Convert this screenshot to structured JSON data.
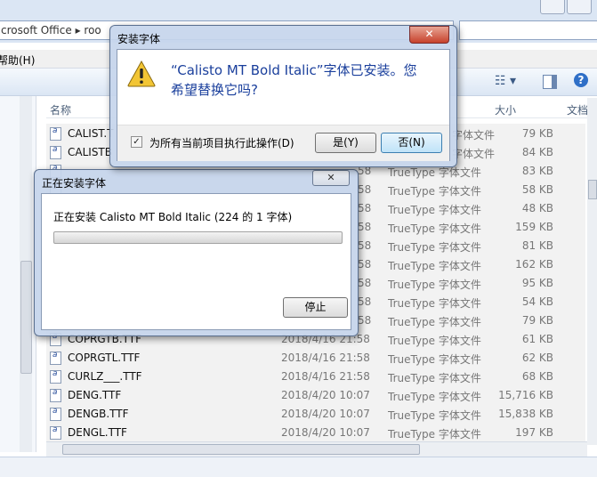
{
  "explorer": {
    "address_text": "crosoft Office  ▸  roo",
    "menu_help": "帮助(H)",
    "columns": {
      "name": "名称",
      "size": "大小",
      "type": "文档"
    },
    "files": [
      {
        "name": "CALIST.T",
        "date": "",
        "type": "",
        "size": ""
      },
      {
        "name": "CALISTB",
        "date": "",
        "type": "",
        "size": ""
      },
      {
        "name": "",
        "date": "",
        "type": "",
        "size": ""
      },
      {
        "name": "",
        "date": "",
        "type": "",
        "size": ""
      },
      {
        "name": "",
        "date": "",
        "type": "",
        "size": ""
      },
      {
        "name": "",
        "date": "",
        "type": "",
        "size": ""
      },
      {
        "name": "",
        "date": "",
        "type": "",
        "size": ""
      },
      {
        "name": "",
        "date": "",
        "type": "",
        "size": ""
      },
      {
        "name": "",
        "date": "",
        "type": "",
        "size": ""
      },
      {
        "name": "",
        "date": "",
        "type": "",
        "size": ""
      },
      {
        "name": "",
        "date": "",
        "type": "",
        "size": ""
      },
      {
        "name": "COPRGTB.TTF",
        "date": "2018/4/16 21:58",
        "type": "TrueType 字体文件",
        "size": "61 KB"
      },
      {
        "name": "COPRGTL.TTF",
        "date": "2018/4/16 21:58",
        "type": "TrueType 字体文件",
        "size": "62 KB"
      },
      {
        "name": "CURLZ___.TTF",
        "date": "2018/4/16 21:58",
        "type": "TrueType 字体文件",
        "size": "68 KB"
      },
      {
        "name": "DENG.TTF",
        "date": "2018/4/20 10:07",
        "type": "TrueType 字体文件",
        "size": "15,716 KB"
      },
      {
        "name": "DENGB.TTF",
        "date": "2018/4/20 10:07",
        "type": "TrueType 字体文件",
        "size": "15,838 KB"
      },
      {
        "name": "DENGL.TTF",
        "date": "2018/4/20 10:07",
        "type": "TrueType 字体文件",
        "size": "197 KB"
      }
    ],
    "partial_rows": [
      {
        "date": "58",
        "type": "TrueType 字体文件",
        "size": "83 KB"
      },
      {
        "date": "58",
        "type": "TrueType 字体文件",
        "size": "58 KB"
      },
      {
        "date": "58",
        "type": "TrueType 字体文件",
        "size": "48 KB"
      },
      {
        "date": "58",
        "type": "TrueType 字体文件",
        "size": "159 KB"
      },
      {
        "date": "58",
        "type": "TrueType 字体文件",
        "size": "81 KB"
      },
      {
        "date": "58",
        "type": "TrueType 字体文件",
        "size": "162 KB"
      },
      {
        "date": "58",
        "type": "TrueType 字体文件",
        "size": "95 KB"
      },
      {
        "date": "58",
        "type": "TrueType 字体文件",
        "size": "54 KB"
      },
      {
        "date": "58",
        "type": "TrueType 字体文件",
        "size": "79 KB"
      }
    ],
    "top_rows_right": [
      {
        "type": "字体文件",
        "size": "79 KB"
      },
      {
        "type": "字体文件",
        "size": "84 KB"
      }
    ]
  },
  "confirm_dialog": {
    "title": "安装字体",
    "question_line1": "“Calisto MT Bold Italic”字体已安装。您",
    "question_line2": "希望替换它吗?",
    "checkbox_label": "为所有当前项目执行此操作(D)",
    "checkbox_checked": true,
    "yes_label": "是(Y)",
    "no_label": "否(N)",
    "close_glyph": "✕"
  },
  "progress_dialog": {
    "title": "正在安装字体",
    "status_text": "正在安装 Calisto MT Bold Italic (224 的 1 字体)",
    "progress": 0,
    "stop_label": "停止",
    "close_glyph": "✕"
  }
}
